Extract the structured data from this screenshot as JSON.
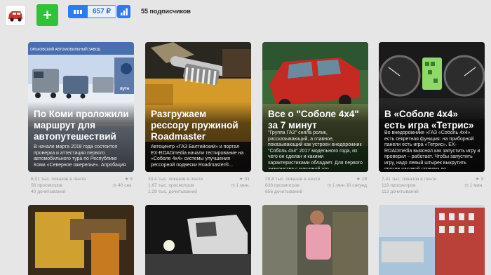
{
  "header": {
    "price": "657 ₽",
    "subscribers": "55 подписчиков",
    "add_label": "+",
    "colors": {
      "accent_blue": "#2b7bf2",
      "accent_green": "#2fc23b"
    }
  },
  "cards": [
    {
      "title": "По Коми проложили маршрут для автопутешествий",
      "desc": "В начале марта 2018 года состоится проверка и аттестация первого автомобильного тура по Республике Коми «Северное ожерелье». Апробация тура...",
      "banner": "ОРЬКОВСКИЙ АВТОМОБИЛЬНЫЙ ЗАВОД",
      "sign": "путе",
      "shows": "6,01 тыс.",
      "shows_label": "показов в ленте",
      "likes": "5",
      "views": "56",
      "views_label": "просмотров",
      "time": "40 сек.",
      "reads": "40",
      "reads_label": "дочитываний"
    },
    {
      "title": "Разгружаем рессору пружиной Roadmaster",
      "desc": "Автоцентр «ГАЗ Балтийский» и портал EX-ROADmedia начали тестирование на «Соболе 4х4» системы улучшения рессорной подвески Roadmaster®...",
      "shows": "33,4 тыс.",
      "shows_label": "показов в ленте",
      "likes": "31",
      "views": "1,67 тыс.",
      "views_label": "просмотров",
      "time": "1 мин.",
      "reads": "1,29 тыс.",
      "reads_label": "дочитываний"
    },
    {
      "title": "Все о \"Соболе 4х4\" за 7 минут",
      "desc": "\"Группа ГАЗ\" сняла ролик, рассказывающий, а главное, показывающий как устроен внедорожник \"Соболь 4х4\" 2017 модельного года, из чего он сделан и какими характеристиками обладает. Для первого знакомства с машиной это...",
      "shows": "28,8 тыс.",
      "shows_label": "показов в ленте",
      "likes": "18",
      "views": "838",
      "views_label": "просмотров",
      "time": "1 мин 30 секунд",
      "reads": "656",
      "reads_label": "дочитываний"
    },
    {
      "title": "В «Соболе 4х4» есть игра «Тетрис»",
      "desc": "Во внедорожнике «ГАЗ «Соболь 4х4» есть секретная функция: на приборной панели есть игра «Тетрис». EX-ROADmedia выяснял как запустить игру и проверил – работает. Чтобы запустить игру, надо левый штырек выкрутить против часовой стрелки до...",
      "shows": "7,41 тыс.",
      "shows_label": "показов в ленте",
      "likes": "3",
      "views": "119",
      "views_label": "просмотров",
      "time": "1 мин.",
      "reads": "113",
      "reads_label": "дочитываний"
    }
  ]
}
